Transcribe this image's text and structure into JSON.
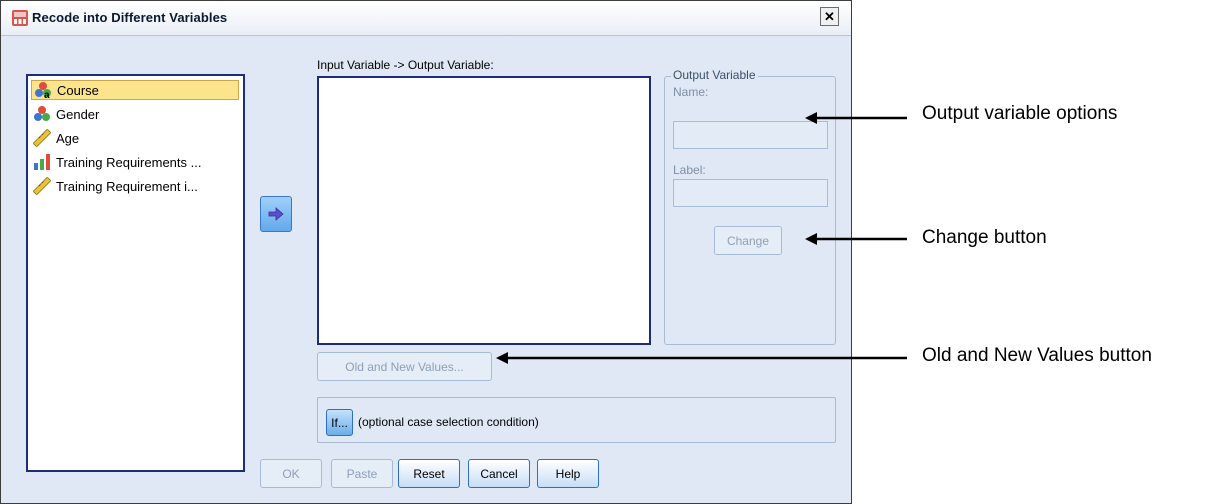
{
  "window": {
    "title": "Recode into Different Variables",
    "close_label": "✕"
  },
  "variables": {
    "items": [
      {
        "label": "Course",
        "icon": "nominal-variable-icon",
        "selected": true
      },
      {
        "label": "Gender",
        "icon": "nominal-variable-icon",
        "selected": false
      },
      {
        "label": "Age",
        "icon": "scale-variable-icon",
        "selected": false
      },
      {
        "label": "Training Requirements ...",
        "icon": "ordinal-variable-icon",
        "selected": false
      },
      {
        "label": "Training Requirement i...",
        "icon": "scale-variable-icon",
        "selected": false
      }
    ]
  },
  "io_list": {
    "label": "Input Variable -> Output Variable:"
  },
  "output_variable": {
    "group_title": "Output Variable",
    "name_label": "Name:",
    "name_value": "",
    "label_label": "Label:",
    "label_value": "",
    "change_label": "Change"
  },
  "old_new_label": "Old and New Values...",
  "if_section": {
    "button_label": "If...",
    "text": "(optional case selection condition)"
  },
  "buttons": {
    "ok": "OK",
    "paste": "Paste",
    "reset": "Reset",
    "cancel": "Cancel",
    "help": "Help"
  },
  "annotations": {
    "output_options": "Output variable options",
    "change_button": "Change button",
    "old_new_button": "Old and New Values button"
  },
  "colors": {
    "dialog_bg": "#dfe8f4",
    "list_border": "#1d2c7d",
    "selection": "#fbe48c",
    "button_border": "#2e6fc3"
  }
}
